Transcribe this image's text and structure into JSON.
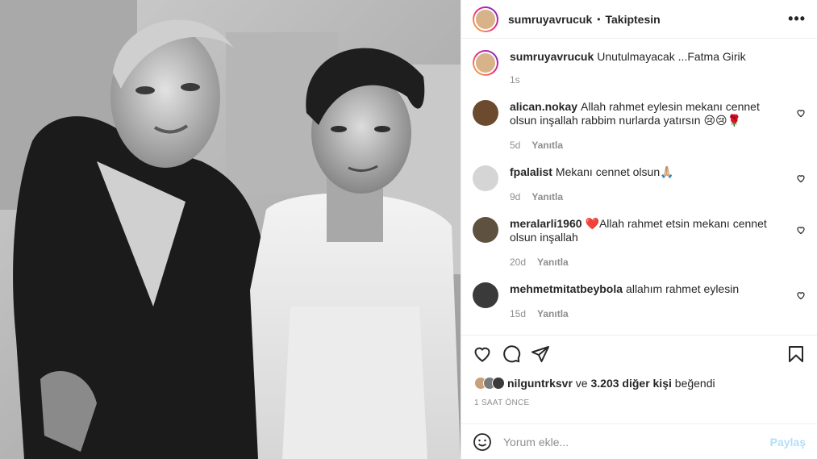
{
  "post": {
    "author": "sumruyavrucuk",
    "separator": "•",
    "follow_label": "Takiptesin",
    "more_label": "•••",
    "photo_alt_icon": "photo"
  },
  "caption": {
    "username": "sumruyavrucuk",
    "text": "Unutulmayacak ...Fatma Girik",
    "age": "1s"
  },
  "comments": [
    {
      "username": "alican.nokay",
      "text": "Allah rahmet eylesin mekanı cennet olsun inşallah rabbim nurlarda yatırsın 😢😢🌹",
      "age": "5d",
      "reply": "Yanıtla"
    },
    {
      "username": "fpalalist",
      "text": "Mekanı cennet olsun🙏🏼",
      "age": "9d",
      "reply": "Yanıtla"
    },
    {
      "username": "meralarli1960",
      "text": "❤️Allah rahmet etsin mekanı cennet olsun inşallah",
      "age": "20d",
      "reply": "Yanıtla"
    },
    {
      "username": "mehmetmitatbeybola",
      "text": "allahım rahmet eylesin",
      "age": "15d",
      "reply": "Yanıtla"
    }
  ],
  "likes": {
    "first_user": "nilguntrksvr",
    "connector": "ve",
    "others": "3.203 diğer kişi",
    "suffix": "beğendi"
  },
  "timestamp": "1 SAAT ÖNCE",
  "add_comment": {
    "placeholder": "Yorum ekle...",
    "post_label": "Paylaş"
  },
  "icons": {
    "like": "heart-icon",
    "comment": "comment-icon",
    "share": "send-icon",
    "save": "bookmark-icon",
    "emoji": "emoji-icon"
  },
  "colors": {
    "text": "#262626",
    "muted": "#8e8e8e",
    "post_button_disabled": "#b2dffc",
    "border": "#efefef"
  }
}
